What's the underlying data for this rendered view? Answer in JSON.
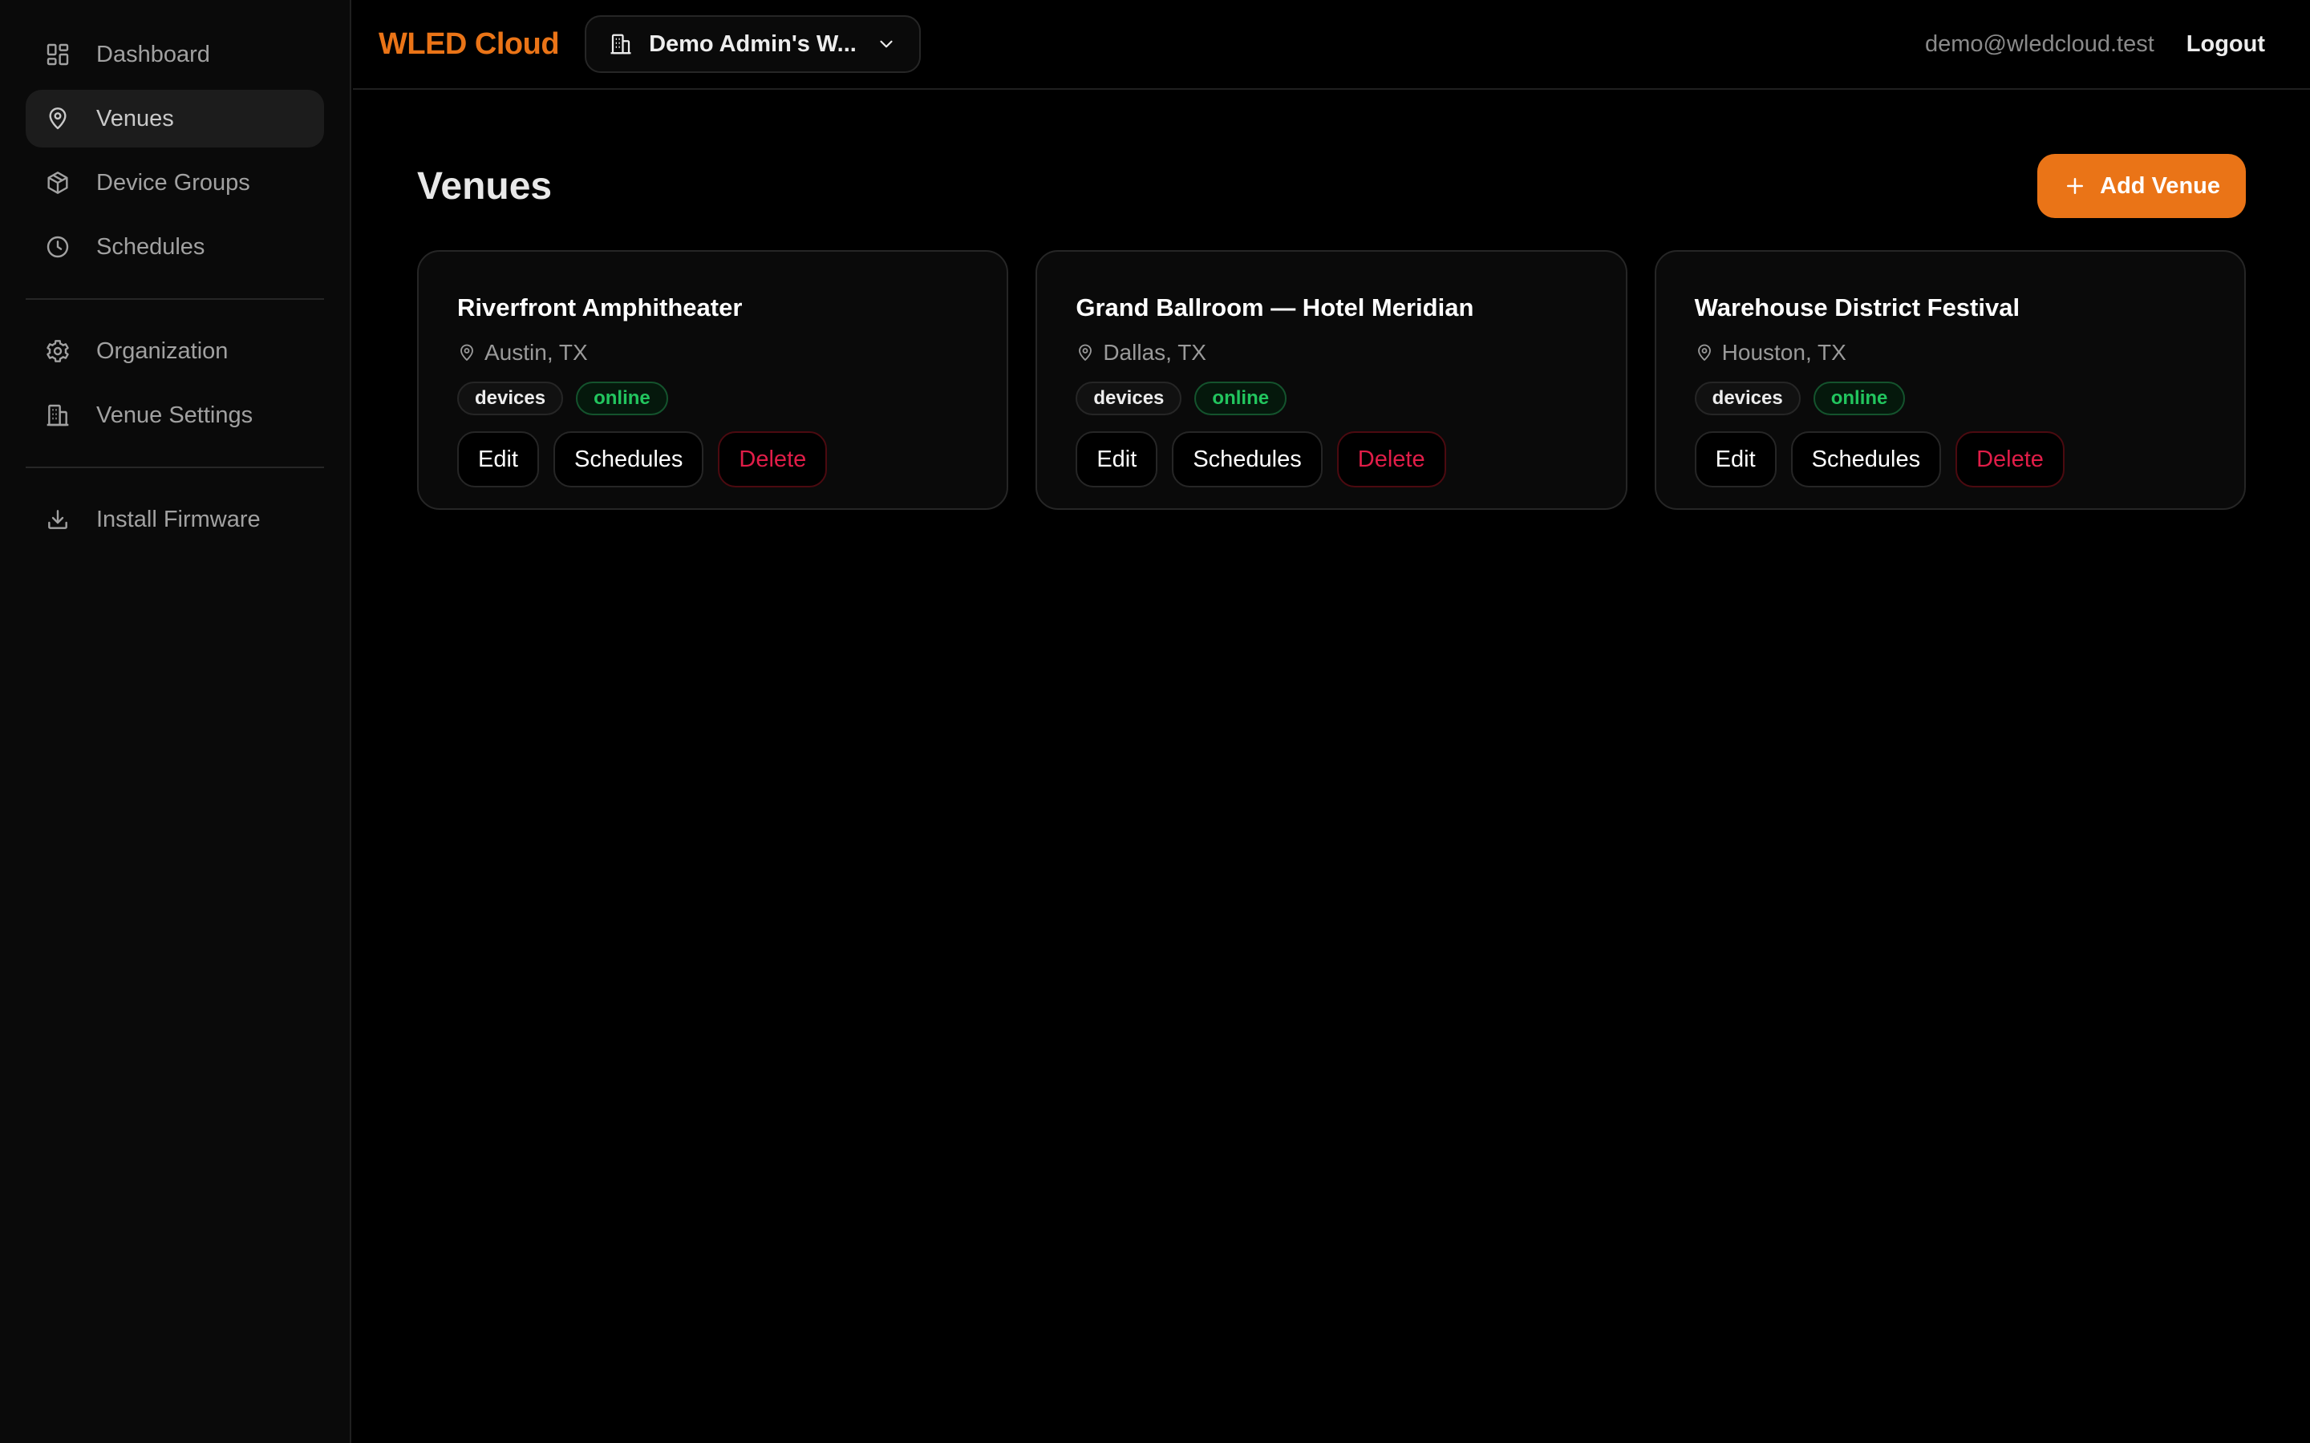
{
  "sidebar": {
    "group1": [
      {
        "label": "Dashboard",
        "icon": "grid-icon",
        "active": false
      },
      {
        "label": "Venues",
        "icon": "map-pin-icon",
        "active": true
      },
      {
        "label": "Device Groups",
        "icon": "box-icon",
        "active": false
      },
      {
        "label": "Schedules",
        "icon": "clock-icon",
        "active": false
      }
    ],
    "group2": [
      {
        "label": "Organization",
        "icon": "gear-icon",
        "active": false
      },
      {
        "label": "Venue Settings",
        "icon": "building-icon",
        "active": false
      }
    ],
    "group3": [
      {
        "label": "Install Firmware",
        "icon": "download-icon",
        "active": false
      }
    ]
  },
  "header": {
    "brand": "WLED Cloud",
    "org_switcher": "Demo Admin's W...",
    "user_email": "demo@wledcloud.test",
    "logout": "Logout"
  },
  "main": {
    "title": "Venues",
    "add_button": "Add Venue",
    "venues": [
      {
        "name": "Riverfront Amphitheater",
        "location": "Austin, TX",
        "badges": [
          "devices",
          "online"
        ],
        "actions": {
          "edit": "Edit",
          "schedules": "Schedules",
          "delete": "Delete"
        }
      },
      {
        "name": "Grand Ballroom — Hotel Meridian",
        "location": "Dallas, TX",
        "badges": [
          "devices",
          "online"
        ],
        "actions": {
          "edit": "Edit",
          "schedules": "Schedules",
          "delete": "Delete"
        }
      },
      {
        "name": "Warehouse District Festival",
        "location": "Houston, TX",
        "badges": [
          "devices",
          "online"
        ],
        "actions": {
          "edit": "Edit",
          "schedules": "Schedules",
          "delete": "Delete"
        }
      }
    ]
  },
  "colors": {
    "accent": "#ea7417",
    "online": "#22c55e",
    "danger": "#e11d48",
    "background": "#000000",
    "sidebar": "#0a0a0a"
  }
}
